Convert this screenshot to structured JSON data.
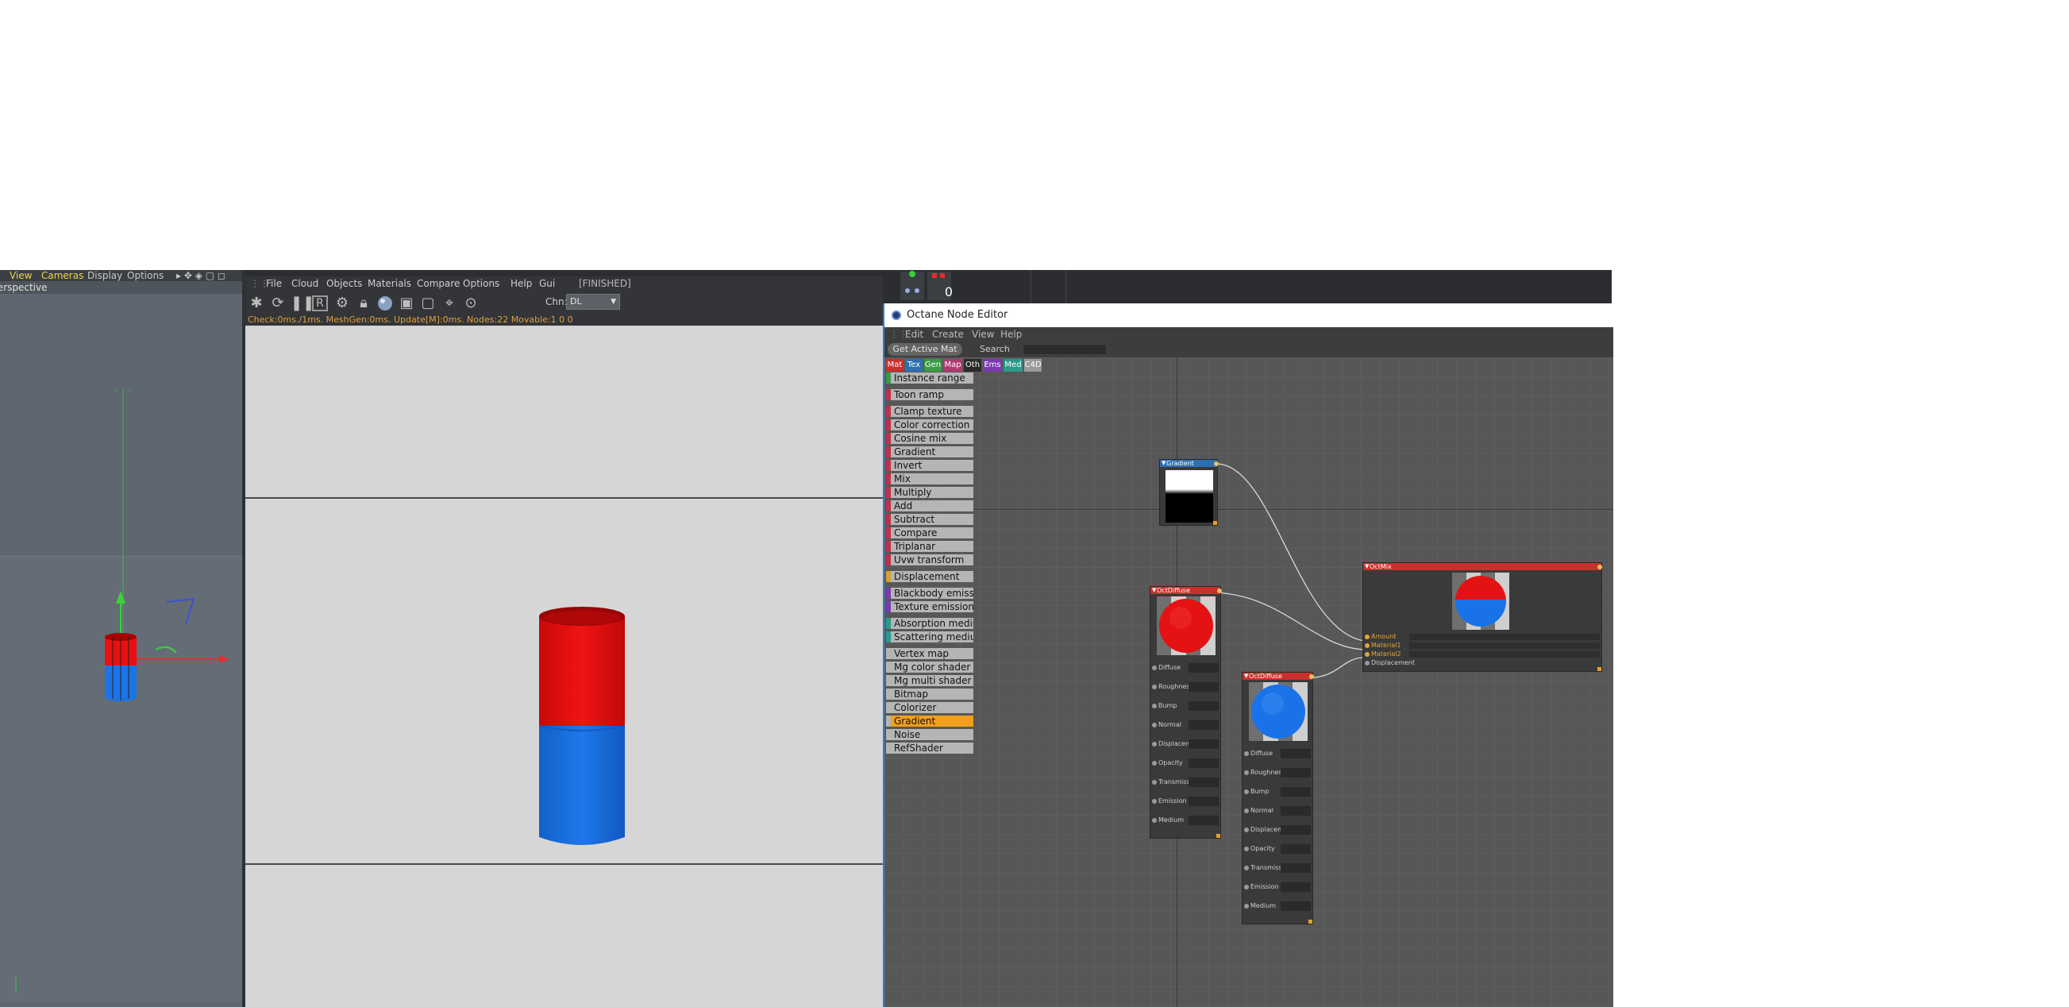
{
  "viewport": {
    "menu": [
      "View",
      "Cameras",
      "Display",
      "Options"
    ],
    "label": "Perspective",
    "colors": {
      "axis_y": "#3ad13a",
      "axis_x": "#e03030",
      "axis_z": "#4050d0",
      "cyl_top": "#e81010",
      "cyl_bottom": "#1c74e6"
    }
  },
  "render": {
    "menu": [
      "File",
      "Cloud",
      "Objects",
      "Materials",
      "Compare",
      "Options",
      "Help",
      "Gui"
    ],
    "finished": "[FINISHED]",
    "channel_label": "Chn:",
    "channel_value": "DL",
    "status": "Check:0ms./1ms. MeshGen:0ms. Update[M]:0ms. Nodes:22 Movable:1 0 0",
    "toolbar_icons": [
      "send-icon",
      "refresh-icon",
      "pause-icon",
      "region-render-icon",
      "settings-gear-icon",
      "lock-icon",
      "material-sphere-icon",
      "clay-mode-icon",
      "frame-icon",
      "pick-icon",
      "focus-pick-icon"
    ],
    "colors": {
      "status": "#e0a040",
      "cyl_red": "#e41010",
      "cyl_blue": "#1b72e6"
    }
  },
  "strip": {
    "number": "0"
  },
  "node_editor": {
    "title": "Octane Node Editor",
    "menu": [
      "Edit",
      "Create",
      "View",
      "Help"
    ],
    "get_active_mat": "Get Active Mat",
    "search_label": "Search",
    "search_value": "",
    "tabs": [
      {
        "label": "Mat",
        "color": "#c9302c"
      },
      {
        "label": "Tex",
        "color": "#2d6fb0"
      },
      {
        "label": "Gen",
        "color": "#3a9a46"
      },
      {
        "label": "Map",
        "color": "#b13a70"
      },
      {
        "label": "Oth",
        "color": "#2a2a2a"
      },
      {
        "label": "Ems",
        "color": "#7b3ab0"
      },
      {
        "label": "Med",
        "color": "#2a9a8a"
      },
      {
        "label": "C4D",
        "color": "#9a9a9a"
      }
    ],
    "palette": [
      {
        "label": "Instance range",
        "stripe": "#3a9a46"
      },
      {
        "label": "Toon ramp",
        "stripe": "#c0304a"
      },
      {
        "label": "Clamp texture",
        "stripe": "#c0304a"
      },
      {
        "label": "Color correction",
        "stripe": "#c0304a"
      },
      {
        "label": "Cosine mix",
        "stripe": "#c0304a"
      },
      {
        "label": "Gradient",
        "stripe": "#c0304a"
      },
      {
        "label": "Invert",
        "stripe": "#c0304a"
      },
      {
        "label": "Mix",
        "stripe": "#c0304a"
      },
      {
        "label": "Multiply",
        "stripe": "#c0304a"
      },
      {
        "label": "Add",
        "stripe": "#c0304a"
      },
      {
        "label": "Subtract",
        "stripe": "#c0304a"
      },
      {
        "label": "Compare",
        "stripe": "#c0304a"
      },
      {
        "label": "Triplanar",
        "stripe": "#c0304a"
      },
      {
        "label": "Uvw transform",
        "stripe": "#c0304a"
      },
      {
        "label": "Displacement",
        "stripe": "#d8a030"
      },
      {
        "label": "Blackbody emission",
        "stripe": "#7b3ab0"
      },
      {
        "label": "Texture emission",
        "stripe": "#7b3ab0"
      },
      {
        "label": "Absorption medium",
        "stripe": "#2a9a8a"
      },
      {
        "label": "Scattering medium",
        "stripe": "#2a9a8a"
      },
      {
        "label": "Vertex map",
        "stripe": "#b5b5b5"
      },
      {
        "label": "Mg color shader",
        "stripe": "#b5b5b5"
      },
      {
        "label": "Mg multi shader",
        "stripe": "#b5b5b5"
      },
      {
        "label": "Bitmap",
        "stripe": "#b5b5b5"
      },
      {
        "label": "Colorizer",
        "stripe": "#b5b5b5"
      },
      {
        "label": "Gradient",
        "stripe": "#b5b5b5"
      },
      {
        "label": "Noise",
        "stripe": "#b5b5b5"
      },
      {
        "label": "RefShader",
        "stripe": "#b5b5b5"
      }
    ],
    "selected_palette_index": 24,
    "nodes": {
      "gradient": {
        "title": "Gradient",
        "head_color": "#2d6fb0"
      },
      "diffuse_red": {
        "title": "OctDiffuse",
        "head_color": "#c9302c",
        "preview": "#e41212"
      },
      "diffuse_blue": {
        "title": "OctDiffuse",
        "head_color": "#c9302c",
        "preview": "#1a72e8"
      },
      "mix": {
        "title": "OctMix",
        "head_color": "#c9302c",
        "inputs": [
          "Amount",
          "Material1",
          "Material2",
          "Displacement"
        ]
      }
    },
    "diffuse_pins": [
      "Diffuse",
      "Roughness",
      "Bump",
      "Normal",
      "Displacement",
      "Opacity",
      "Transmission",
      "Emission",
      "Medium"
    ]
  }
}
